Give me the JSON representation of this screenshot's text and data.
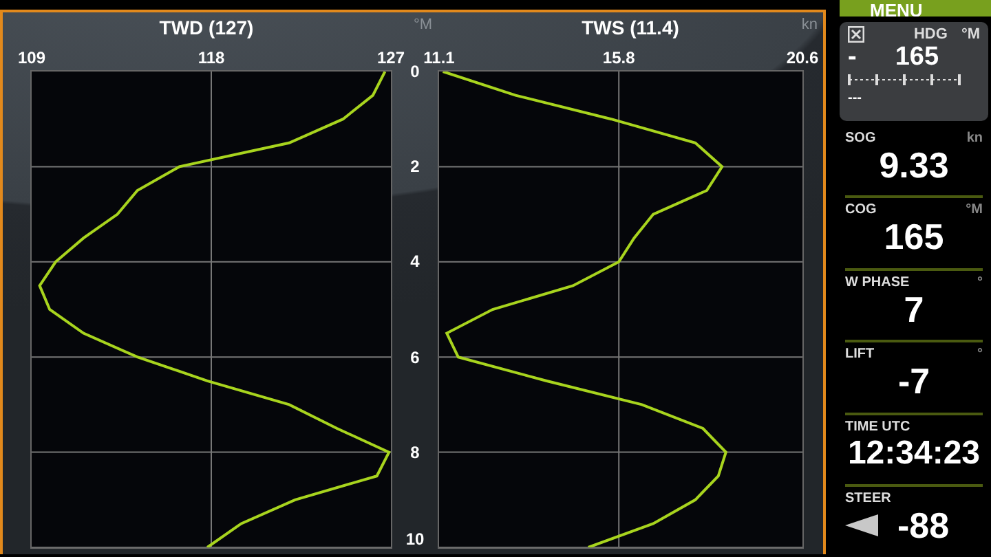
{
  "charts": [
    {
      "unit": "°M",
      "chart_data": {
        "type": "line",
        "orientation": "horizontal",
        "title": "TWD (127)",
        "x": [
          0,
          0.5,
          1,
          1.5,
          2,
          2.5,
          3,
          3.5,
          4,
          4.5,
          5,
          5.5,
          6,
          6.5,
          7,
          7.5,
          8,
          8.5,
          9,
          9.5,
          10
        ],
        "series": [
          {
            "color": "#a8d41e",
            "values": [
              126.7,
              126.1,
              124.6,
              121.9,
              116.4,
              114.3,
              113.3,
              111.6,
              110.2,
              109.4,
              109.9,
              111.6,
              114.3,
              117.8,
              121.9,
              124.3,
              126.9,
              126.3,
              122.2,
              119.5,
              117.8
            ]
          }
        ],
        "grid": true,
        "xlim": [
          109,
          127
        ],
        "ylim": [
          10,
          0
        ],
        "xticks": [
          109,
          118,
          127
        ],
        "yticks": [
          0,
          2,
          4,
          6,
          8,
          10
        ]
      }
    },
    {
      "unit": "kn",
      "chart_data": {
        "type": "line",
        "orientation": "horizontal",
        "title": "TWS (11.4)",
        "x": [
          0,
          0.5,
          1,
          1.5,
          2,
          2.5,
          3,
          3.5,
          4,
          4.5,
          5,
          5.5,
          6,
          6.5,
          7,
          7.5,
          8,
          8.5,
          9,
          9.5,
          10
        ],
        "series": [
          {
            "color": "#a8d41e",
            "values": [
              11.2,
              13.1,
              15.6,
              17.8,
              18.5,
              18.1,
              16.7,
              16.2,
              15.8,
              14.6,
              12.5,
              11.3,
              11.6,
              13.9,
              16.4,
              18.0,
              18.6,
              18.4,
              17.8,
              16.7,
              15.0
            ]
          }
        ],
        "grid": true,
        "xlim": [
          11.1,
          20.6
        ],
        "ylim": [
          10,
          0
        ],
        "xticks": [
          11.1,
          15.8,
          20.6
        ]
      }
    }
  ],
  "menu_button": "MENU",
  "heading_box": {
    "label": "HDG",
    "unit": "°M",
    "sign": "-",
    "value": "165",
    "footer": "---"
  },
  "data_rows": [
    {
      "kind": "value",
      "label": "SOG",
      "unit": "kn",
      "value": "9.33"
    },
    {
      "kind": "value",
      "label": "COG",
      "unit": "°M",
      "value": "165"
    },
    {
      "kind": "value",
      "label": "W PHASE",
      "unit": "°",
      "value": "7"
    },
    {
      "kind": "value",
      "label": "LIFT",
      "unit": "°",
      "value": "-7"
    },
    {
      "kind": "value",
      "label": "TIME UTC",
      "value": "12:34:23"
    },
    {
      "kind": "steer",
      "label": "STEER",
      "value": "-88"
    }
  ]
}
